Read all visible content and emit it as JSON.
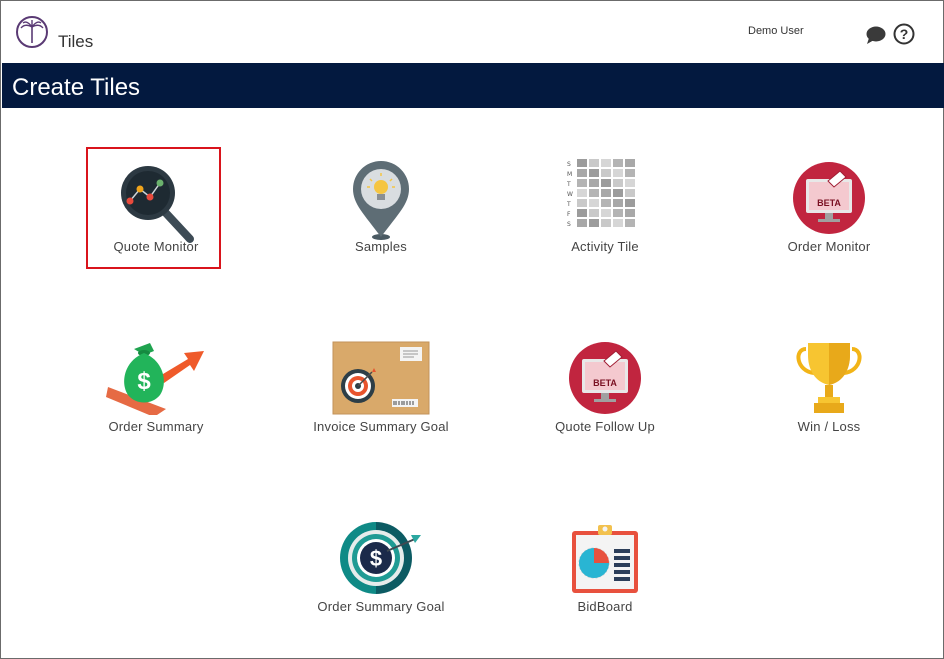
{
  "header": {
    "app_title": "Tiles",
    "user_name": "Demo User",
    "icons": [
      "logo-icon",
      "chat-icon",
      "help-icon"
    ]
  },
  "page": {
    "title": "Create Tiles"
  },
  "tiles": [
    {
      "label": "Quote Monitor",
      "icon": "magnifier-chart-icon",
      "selected": true
    },
    {
      "label": "Samples",
      "icon": "lightbulb-pin-icon"
    },
    {
      "label": "Activity Tile",
      "icon": "calendar-grid-icon",
      "weekdays": [
        "S",
        "M",
        "T",
        "W",
        "T",
        "F",
        "S"
      ]
    },
    {
      "label": "Order Monitor",
      "icon": "beta-monitor-icon",
      "badge": "BETA"
    },
    {
      "label": "Order Summary",
      "icon": "money-bag-arrow-icon",
      "symbol": "$"
    },
    {
      "label": "Invoice Summary Goal",
      "icon": "target-envelope-icon"
    },
    {
      "label": "Quote Follow Up",
      "icon": "beta-monitor-icon",
      "badge": "BETA"
    },
    {
      "label": "Win / Loss",
      "icon": "trophy-icon"
    },
    {
      "label": "Order Summary Goal",
      "icon": "dollar-target-icon",
      "symbol": "$"
    },
    {
      "label": "BidBoard",
      "icon": "clipboard-chart-icon"
    }
  ],
  "colors": {
    "header_bg": "#03193f",
    "selected_border": "#d9141c",
    "beta_red": "#c1253f"
  }
}
